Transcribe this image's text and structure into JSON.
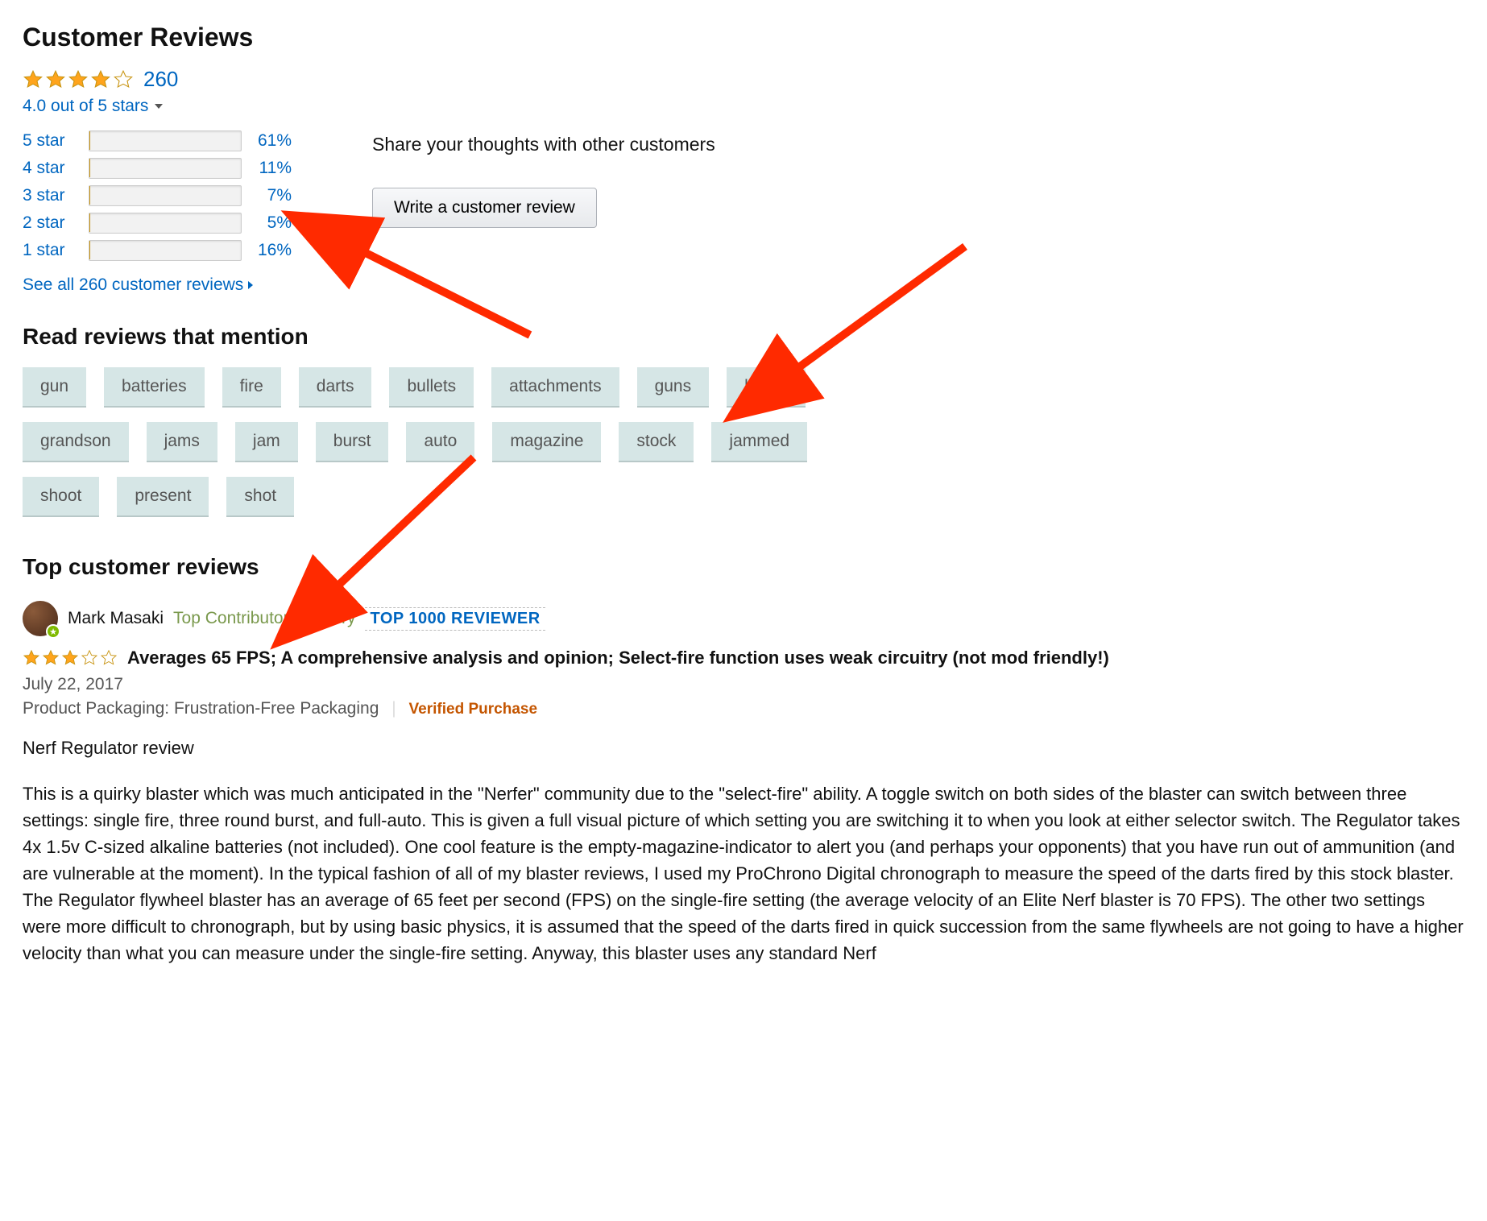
{
  "heading": "Customer Reviews",
  "summary": {
    "overall_stars": 4.0,
    "review_count": "260",
    "rating_text": "4.0 out of 5 stars"
  },
  "histogram": [
    {
      "label": "5 star",
      "pct": 61,
      "pct_text": "61%"
    },
    {
      "label": "4 star",
      "pct": 11,
      "pct_text": "11%"
    },
    {
      "label": "3 star",
      "pct": 7,
      "pct_text": "7%"
    },
    {
      "label": "2 star",
      "pct": 5,
      "pct_text": "5%"
    },
    {
      "label": "1 star",
      "pct": 16,
      "pct_text": "16%"
    }
  ],
  "share_prompt": "Share your thoughts with other customers",
  "write_review_label": "Write a customer review",
  "see_all_label": "See all 260 customer reviews",
  "mentions_heading": "Read reviews that mention",
  "keywords": [
    "gun",
    "batteries",
    "fire",
    "darts",
    "bullets",
    "attachments",
    "guns",
    "barrel",
    "grandson",
    "jams",
    "jam",
    "burst",
    "auto",
    "magazine",
    "stock",
    "jammed",
    "shoot",
    "present",
    "shot"
  ],
  "top_reviews_heading": "Top customer reviews",
  "review": {
    "reviewer_name": "Mark Masaki",
    "contributor_text": "Top Contributor: Archery",
    "top_reviewer_badge": "TOP 1000 REVIEWER",
    "stars": 3,
    "title": "Averages 65 FPS; A comprehensive analysis and opinion; Select-fire function uses weak circuitry (not mod friendly!)",
    "date": "July 22, 2017",
    "packaging": "Product Packaging: Frustration-Free Packaging",
    "verified": "Verified Purchase",
    "intro": "Nerf Regulator review",
    "body": "This is a quirky blaster which was much anticipated in the \"Nerfer\" community due to the \"select-fire\" ability. A toggle switch on both sides of the blaster can switch between three settings: single fire, three round burst, and full-auto. This is given a full visual picture of which setting you are switching it to when you look at either selector switch. The Regulator takes 4x 1.5v C-sized alkaline batteries (not included). One cool feature is the empty-magazine-indicator to alert you (and perhaps your opponents) that you have run out of ammunition (and are vulnerable at the moment). In the typical fashion of all of my blaster reviews, I used my ProChrono Digital chronograph to measure the speed of the darts fired by this stock blaster. The Regulator flywheel blaster has an average of 65 feet per second (FPS) on the single-fire setting (the average velocity of an Elite Nerf blaster is 70 FPS). The other two settings were more difficult to chronograph, but by using basic physics, it is assumed that the speed of the darts fired in quick succession from the same flywheels are not going to have a higher velocity than what you can measure under the single-fire setting. Anyway, this blaster uses any standard Nerf"
  },
  "colors": {
    "link": "#0066c0",
    "star_fill": "#ffa41c",
    "star_empty": "#e7e7e7",
    "verified": "#c45500",
    "arrow": "#ff2a00"
  }
}
